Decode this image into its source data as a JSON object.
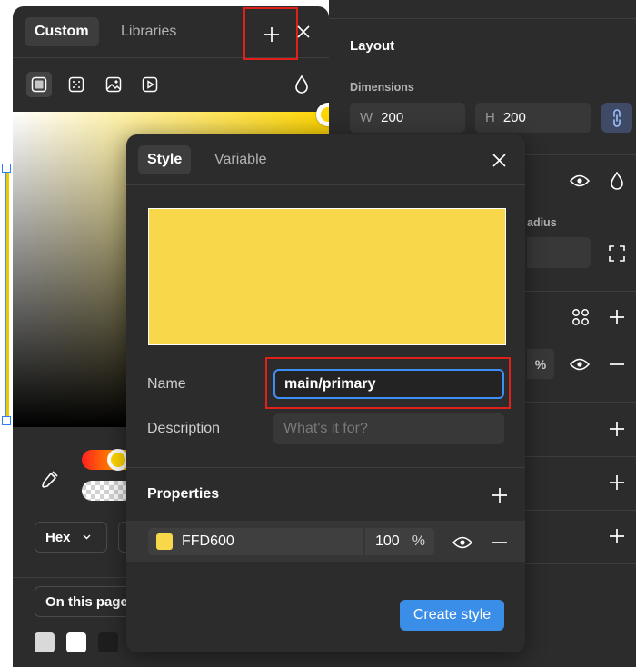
{
  "picker": {
    "tabs": {
      "custom": "Custom",
      "libraries": "Libraries"
    },
    "format": {
      "selected": "Hex"
    },
    "scope": {
      "selected": "On this page"
    },
    "colors": {
      "current": "#FFD600"
    },
    "hue": {
      "level": 0.85
    },
    "swatches": [
      "#d9d9d9",
      "#ffffff",
      "#1e1e1e"
    ]
  },
  "right_panel": {
    "layout_title": "Layout",
    "dimensions_label": "Dimensions",
    "width": {
      "axis": "W",
      "value": "200"
    },
    "height": {
      "axis": "H",
      "value": "200"
    },
    "radius_label": "adius",
    "percent": "%"
  },
  "modal": {
    "tabs": {
      "style": "Style",
      "variable": "Variable"
    },
    "name_label": "Name",
    "name_value": "main/primary",
    "description_label": "Description",
    "description_placeholder": "What's it for?",
    "properties_title": "Properties",
    "fill": {
      "hex": "FFD600",
      "opacity": "100",
      "percent_symbol": "%",
      "color": "#F8D84A"
    },
    "create_button": "Create style"
  },
  "highlight_color": "#e0211b",
  "accent_color": "#3b8ee8"
}
